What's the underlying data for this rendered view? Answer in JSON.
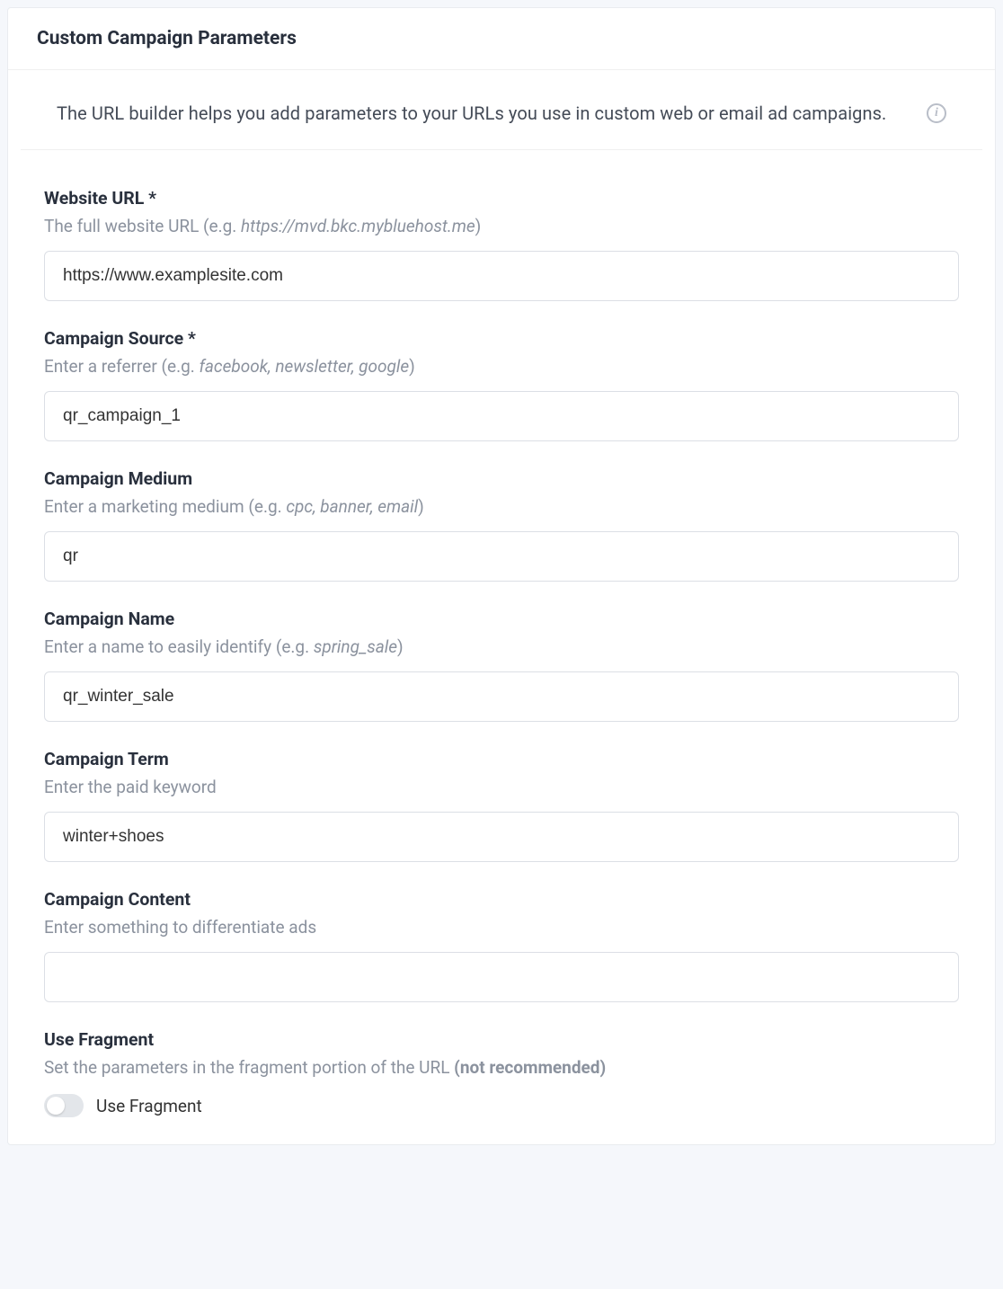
{
  "header": {
    "title": "Custom Campaign Parameters"
  },
  "intro": {
    "text": "The URL builder helps you add parameters to your URLs you use in custom web or email ad campaigns.",
    "info_glyph": "i"
  },
  "fields": {
    "website_url": {
      "label": "Website URL *",
      "help_plain": "The full website URL (e.g. ",
      "help_em": "https://mvd.bkc.mybluehost.me",
      "help_tail": ")",
      "value": "https://www.examplesite.com"
    },
    "campaign_source": {
      "label": "Campaign Source *",
      "help_plain": "Enter a referrer (e.g. ",
      "help_em": "facebook, newsletter, google",
      "help_tail": ")",
      "value": "qr_campaign_1"
    },
    "campaign_medium": {
      "label": "Campaign Medium",
      "help_plain": "Enter a marketing medium (e.g. ",
      "help_em": "cpc, banner, email",
      "help_tail": ")",
      "value": "qr"
    },
    "campaign_name": {
      "label": "Campaign Name",
      "help_plain": "Enter a name to easily identify (e.g. ",
      "help_em": "spring_sale",
      "help_tail": ")",
      "value": "qr_winter_sale"
    },
    "campaign_term": {
      "label": "Campaign Term",
      "help_plain": "Enter the paid keyword",
      "help_em": "",
      "help_tail": "",
      "value": "winter+shoes"
    },
    "campaign_content": {
      "label": "Campaign Content",
      "help_plain": "Enter something to differentiate ads",
      "help_em": "",
      "help_tail": "",
      "value": ""
    }
  },
  "fragment": {
    "label": "Use Fragment",
    "help_plain": "Set the parameters in the fragment portion of the URL ",
    "help_bold": "(not recommended)",
    "toggle_label": "Use Fragment",
    "toggle_on": false
  }
}
